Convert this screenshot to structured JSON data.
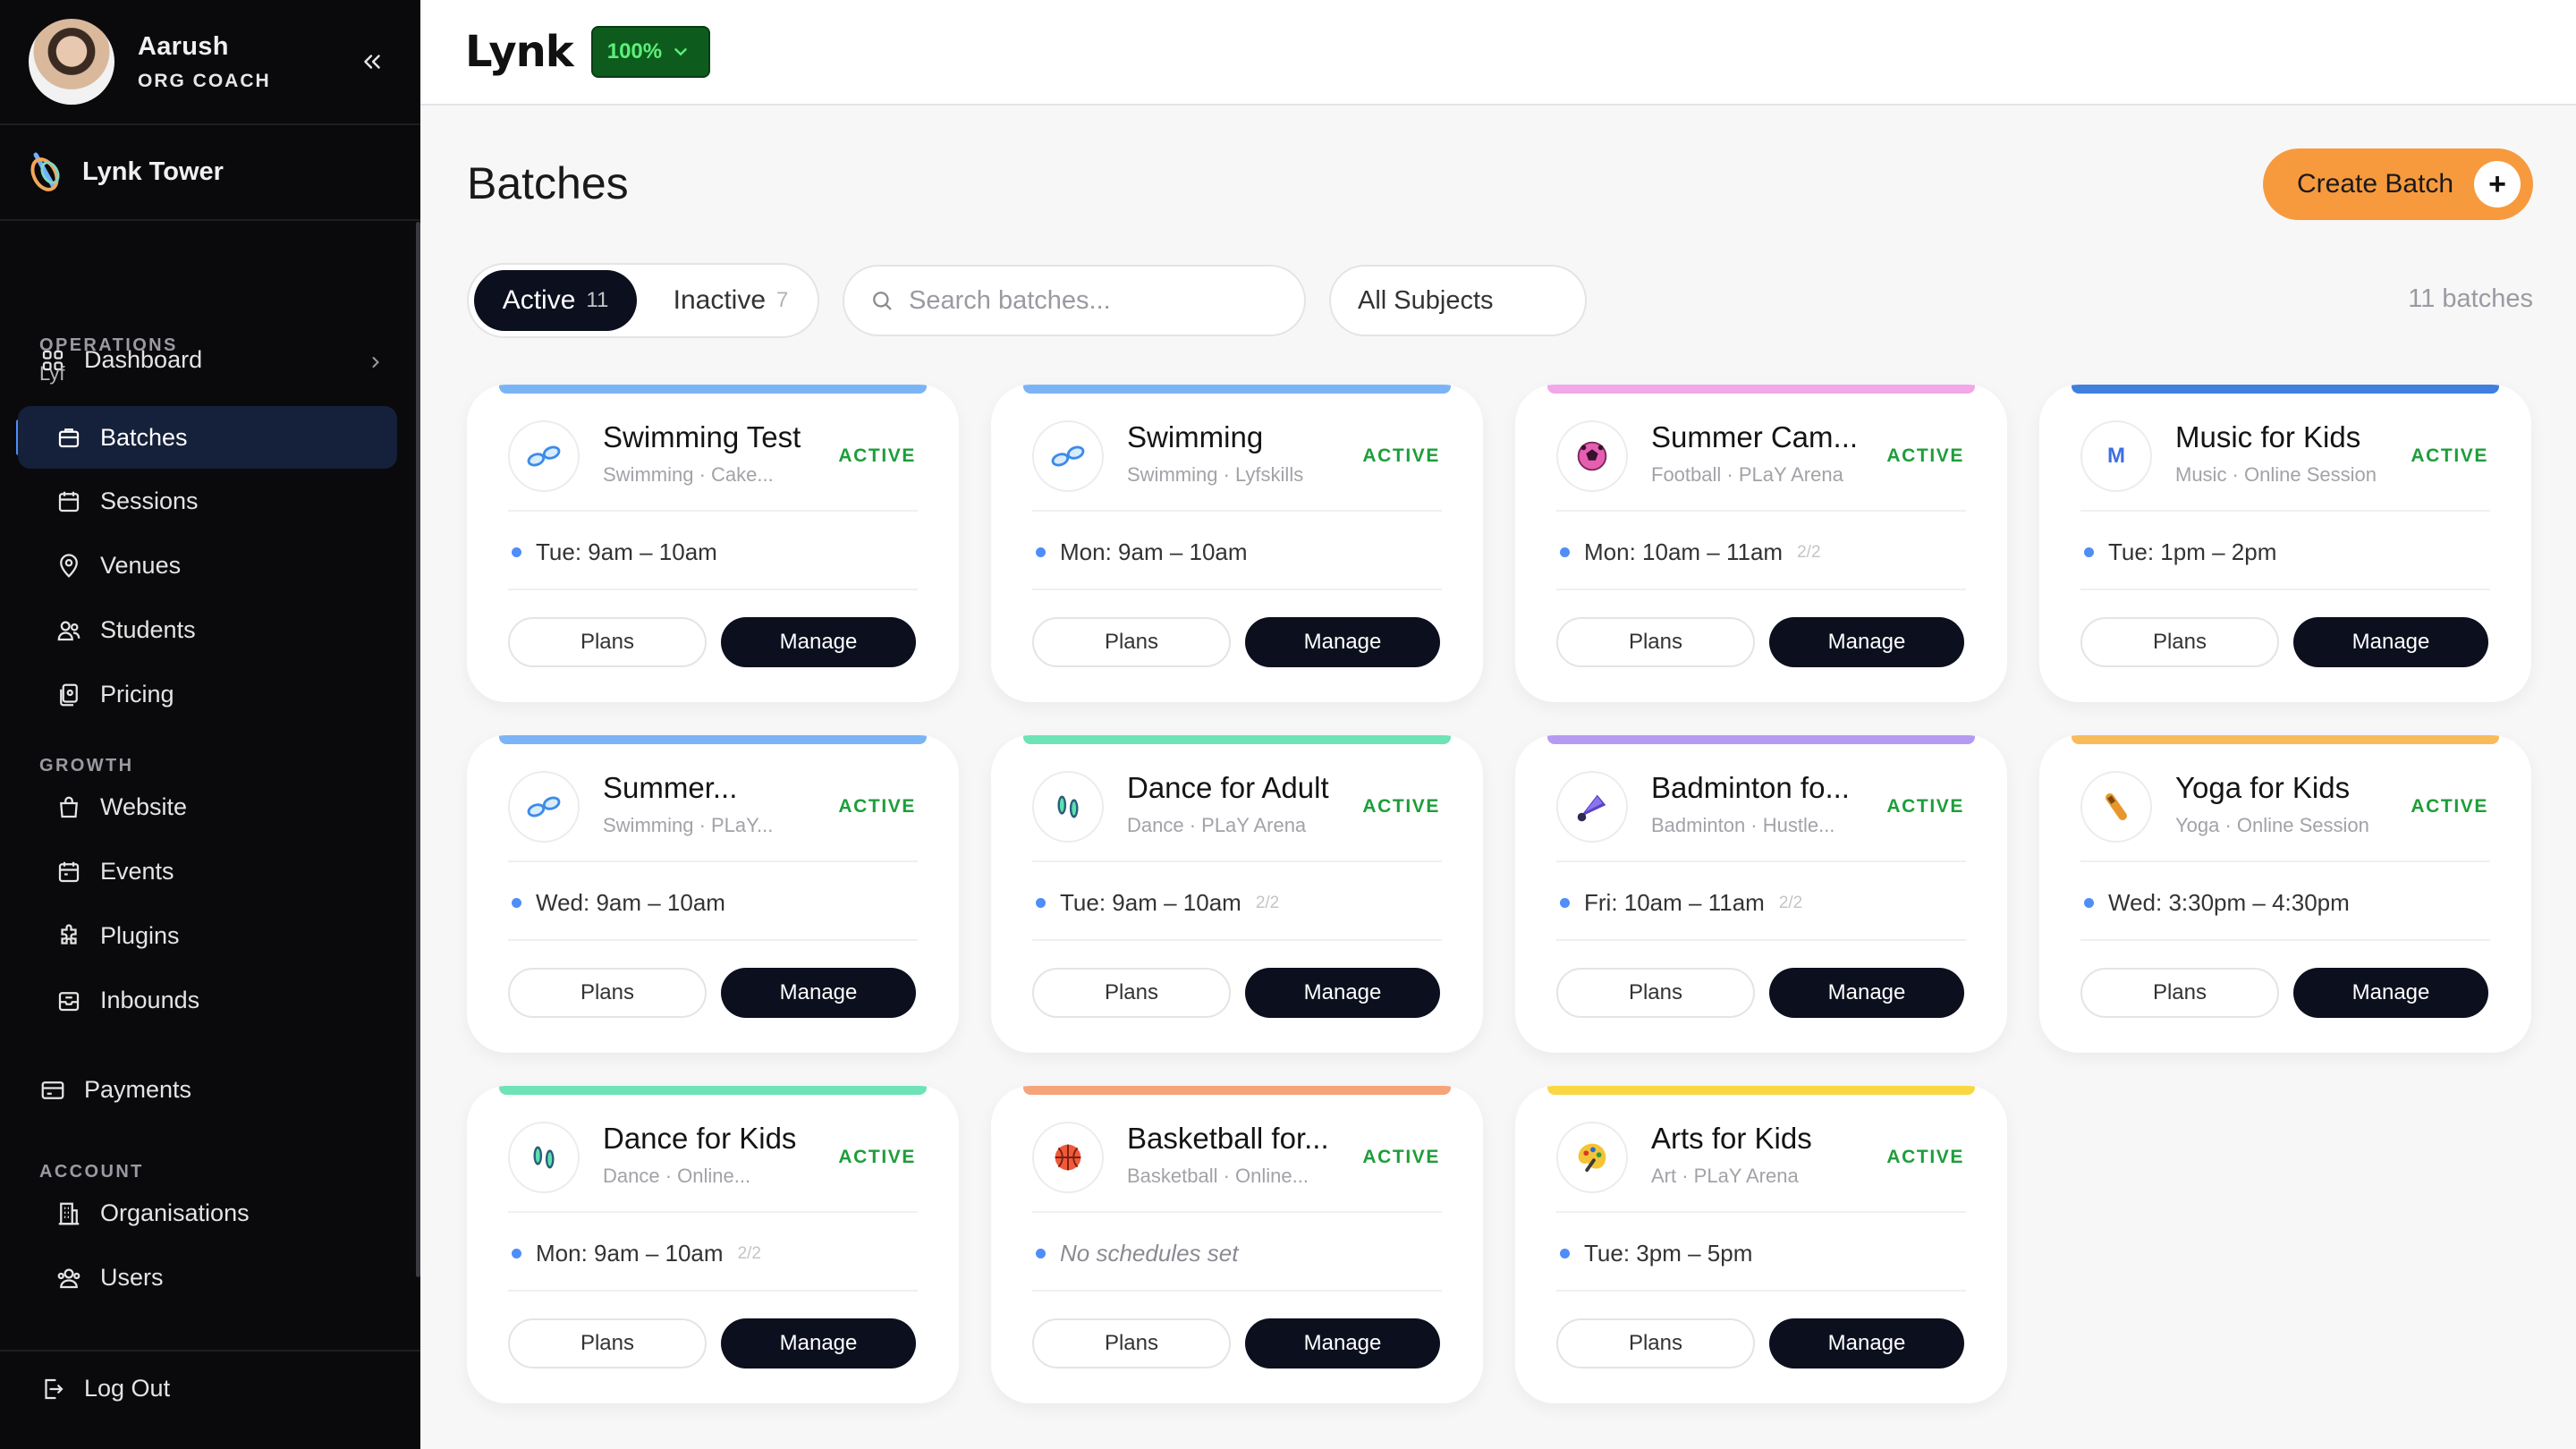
{
  "user": {
    "name": "Aarush",
    "role": "ORG COACH"
  },
  "org": {
    "name": "Lynk Tower"
  },
  "sidebar": {
    "dashboard": "Dashboard",
    "operations_label": "OPERATIONS",
    "operations_sub": "Lyf",
    "ops_items": [
      "Batches",
      "Sessions",
      "Venues",
      "Students",
      "Pricing"
    ],
    "growth_label": "GROWTH",
    "growth_items": [
      "Website",
      "Events",
      "Plugins",
      "Inbounds"
    ],
    "payments": "Payments",
    "account_label": "ACCOUNT",
    "account_items": [
      "Organisations",
      "Users"
    ],
    "logout": "Log Out",
    "active_item": "Batches"
  },
  "topbar": {
    "logo": "Lynk",
    "zoom": "100%"
  },
  "page": {
    "title": "Batches",
    "create_label": "Create Batch",
    "tabs": [
      {
        "label": "Active",
        "count": "11"
      },
      {
        "label": "Inactive",
        "count": "7"
      }
    ],
    "search_placeholder": "Search batches...",
    "subject_filter": "All Subjects",
    "batch_count": "11 batches"
  },
  "colors": {
    "accent_blue": "#4f8df8",
    "create_orange": "#f79a3e",
    "active_green": "#1d9e3a",
    "zoom_badge": "#0d5c1e"
  },
  "cards": [
    {
      "title": "Swimming Test",
      "subtitle": "Swimming · Cake...",
      "status": "ACTIVE",
      "schedule": "Tue: 9am – 10am",
      "capacity": "",
      "icon": "goggles-icon",
      "accent": "#7bb4f6",
      "plans": "Plans",
      "manage": "Manage"
    },
    {
      "title": "Swimming",
      "subtitle": "Swimming · Lyfskills",
      "status": "ACTIVE",
      "schedule": "Mon: 9am – 10am",
      "capacity": "",
      "icon": "goggles-icon",
      "accent": "#7bb4f6",
      "plans": "Plans",
      "manage": "Manage"
    },
    {
      "title": "Summer Cam...",
      "subtitle": "Football · PLaY Arena",
      "status": "ACTIVE",
      "schedule": "Mon: 10am – 11am",
      "capacity": "2/2",
      "icon": "football-icon",
      "accent": "#f2a7e8",
      "plans": "Plans",
      "manage": "Manage"
    },
    {
      "title": "Music for Kids",
      "subtitle": "Music · Online Session",
      "status": "ACTIVE",
      "schedule": "Tue: 1pm – 2pm",
      "capacity": "",
      "icon": "letter-m-icon",
      "icon_text": "M",
      "accent": "#3f7fe0",
      "plans": "Plans",
      "manage": "Manage"
    },
    {
      "title": "Summer...",
      "subtitle": "Swimming · PLaY...",
      "status": "ACTIVE",
      "schedule": "Wed: 9am – 10am",
      "capacity": "",
      "icon": "goggles-icon",
      "accent": "#7bb4f6",
      "plans": "Plans",
      "manage": "Manage"
    },
    {
      "title": "Dance for Adult",
      "subtitle": "Dance · PLaY Arena",
      "status": "ACTIVE",
      "schedule": "Tue: 9am – 10am",
      "capacity": "2/2",
      "icon": "footprints-icon",
      "accent": "#6de3b6",
      "plans": "Plans",
      "manage": "Manage"
    },
    {
      "title": "Badminton fo...",
      "subtitle": "Badminton · Hustle...",
      "status": "ACTIVE",
      "schedule": "Fri: 10am – 11am",
      "capacity": "2/2",
      "icon": "shuttlecock-icon",
      "accent": "#b59af2",
      "plans": "Plans",
      "manage": "Manage"
    },
    {
      "title": "Yoga for Kids",
      "subtitle": "Yoga · Online Session",
      "status": "ACTIVE",
      "schedule": "Wed: 3:30pm – 4:30pm",
      "capacity": "",
      "icon": "yoga-mat-icon",
      "accent": "#f8bb5a",
      "plans": "Plans",
      "manage": "Manage"
    },
    {
      "title": "Dance for Kids",
      "subtitle": "Dance · Online...",
      "status": "ACTIVE",
      "schedule": "Mon: 9am – 10am",
      "capacity": "2/2",
      "icon": "footprints-icon",
      "accent": "#6de3b6",
      "plans": "Plans",
      "manage": "Manage"
    },
    {
      "title": "Basketball for...",
      "subtitle": "Basketball · Online...",
      "status": "ACTIVE",
      "schedule": "No schedules set",
      "capacity": "",
      "empty": true,
      "icon": "basketball-icon",
      "accent": "#f5a47a",
      "plans": "Plans",
      "manage": "Manage"
    },
    {
      "title": "Arts for Kids",
      "subtitle": "Art · PLaY Arena",
      "status": "ACTIVE",
      "schedule": "Tue: 3pm – 5pm",
      "capacity": "",
      "icon": "palette-icon",
      "accent": "#f8d742",
      "plans": "Plans",
      "manage": "Manage"
    }
  ]
}
